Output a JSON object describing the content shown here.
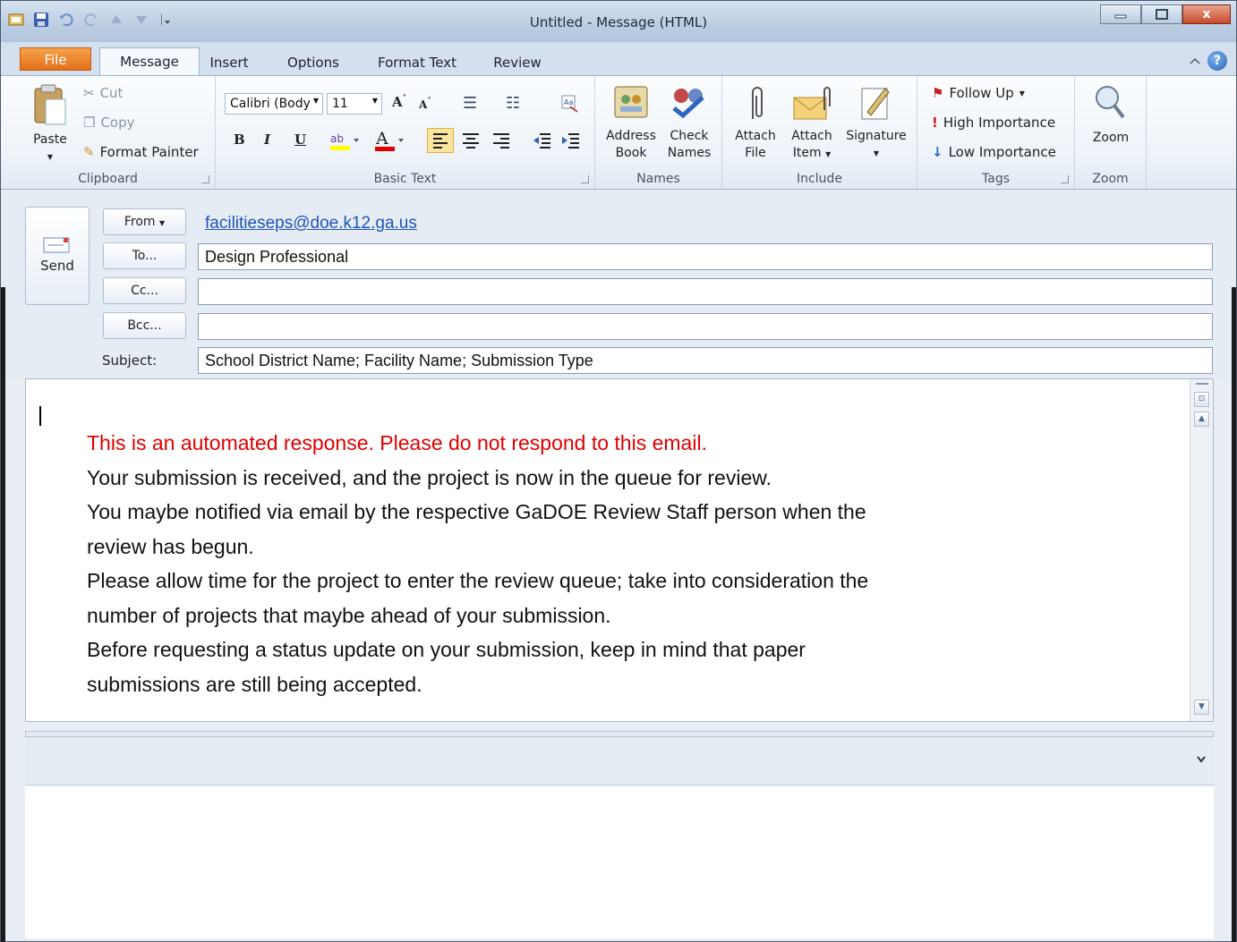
{
  "window": {
    "title": "Untitled  -  Message (HTML)",
    "minimize_glyph": "▁",
    "maximize_glyph": "□",
    "close_glyph": "x"
  },
  "tabs": {
    "file": "File",
    "message": "Message",
    "insert": "Insert",
    "options": "Options",
    "format_text": "Format Text",
    "review": "Review"
  },
  "ribbon": {
    "clipboard": {
      "label": "Clipboard",
      "paste": "Paste",
      "cut": "Cut",
      "copy": "Copy",
      "format_painter": "Format Painter"
    },
    "basic_text": {
      "label": "Basic Text",
      "font_name": "Calibri (Body",
      "font_size": "11",
      "bold": "B",
      "italic": "I",
      "underline": "U"
    },
    "names": {
      "label": "Names",
      "address_book_1": "Address",
      "address_book_2": "Book",
      "check_names_1": "Check",
      "check_names_2": "Names"
    },
    "include": {
      "label": "Include",
      "attach_file_1": "Attach",
      "attach_file_2": "File",
      "attach_item_1": "Attach",
      "attach_item_2": "Item",
      "signature": "Signature"
    },
    "tags": {
      "label": "Tags",
      "follow_up": "Follow Up",
      "high_importance": "High Importance",
      "low_importance": "Low Importance"
    },
    "zoom": {
      "label": "Zoom",
      "zoom": "Zoom"
    }
  },
  "header": {
    "send": "Send",
    "from_button": "From",
    "from_value": "facilitieseps@doe.k12.ga.us",
    "to_button": "To...",
    "to_value": "Design Professional",
    "cc_button": "Cc...",
    "cc_value": "",
    "bcc_button": "Bcc...",
    "bcc_value": "",
    "subject_label": "Subject:",
    "subject_value": "School District Name; Facility Name; Submission Type"
  },
  "body": {
    "line_red": "This is an automated response. Please do not respond to this email.",
    "line2": "Your submission is received, and the project is now in the queue for review.",
    "line3": "You maybe notified via email by the respective GaDOE Review Staff person when the",
    "line4": "review has begun.",
    "line5": "Please allow time for the project to enter the review queue; take into consideration the",
    "line6": "number of projects that maybe ahead of your submission.",
    "line7": "Before requesting a status update on your submission, keep in mind that paper",
    "line8": "submissions are still being accepted."
  },
  "colors": {
    "accent_file_tab": "#e2701a",
    "link_blue": "#1f55b8",
    "automated_notice_red": "#e00000"
  }
}
